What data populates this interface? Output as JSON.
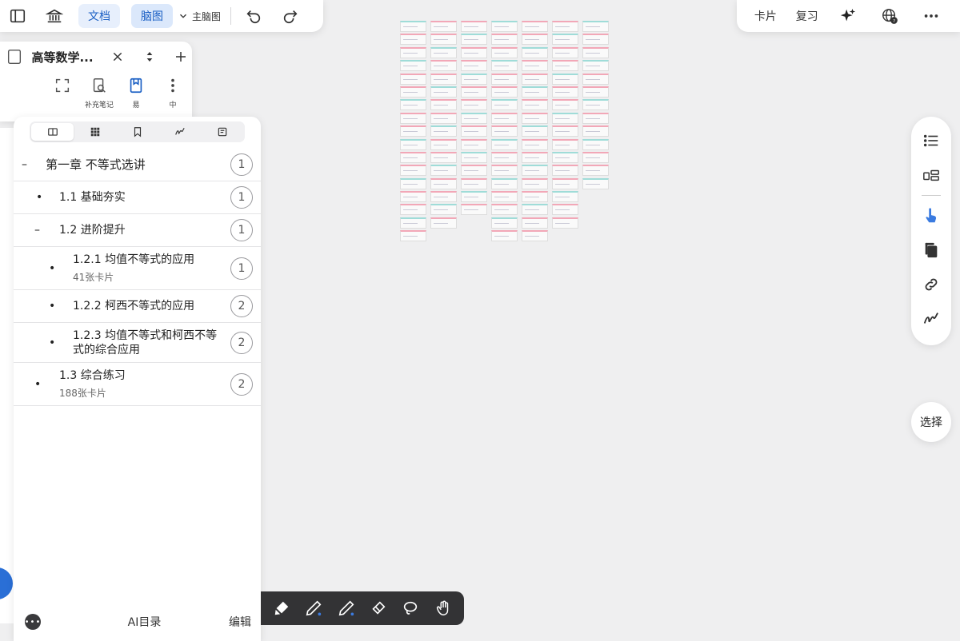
{
  "topbar_left": {
    "doc_label": "文档",
    "mindmap_label": "脑图",
    "main_mindmap_label": "主脑图"
  },
  "topbar_right": {
    "cards_label": "卡片",
    "review_label": "复习"
  },
  "notebook": {
    "title": "高等数学...",
    "tools": [
      {
        "label": "",
        "icon": "expand-icon"
      },
      {
        "label": "补充笔记",
        "icon": "search-note-icon"
      },
      {
        "label": "易",
        "icon": "book-icon"
      },
      {
        "label": "中",
        "icon": "more-vertical-icon"
      }
    ]
  },
  "outline": {
    "tabs": [
      "outline-tab",
      "grid-tab",
      "bookmark-tab",
      "ink-tab",
      "notes-tab"
    ],
    "items": [
      {
        "marker": "–",
        "text": "第一章 不等式选讲",
        "sub": "",
        "count": "1"
      },
      {
        "marker": "•",
        "text": "1.1 基础夯实",
        "sub": "",
        "count": "1"
      },
      {
        "marker": "–",
        "text": "1.2 进阶提升",
        "sub": "",
        "count": "1"
      },
      {
        "marker": "•",
        "text": "1.2.1 均值不等式的应用",
        "sub": "41张卡片",
        "count": "1"
      },
      {
        "marker": "•",
        "text": "1.2.2 柯西不等式的应用",
        "sub": "",
        "count": "2"
      },
      {
        "marker": "•",
        "text": "1.2.3 均值不等式和柯西不等式的综合应用",
        "sub": "",
        "count": "2"
      },
      {
        "marker": "•",
        "text": "1.3 综合练习",
        "sub": "188张卡片",
        "count": "2"
      }
    ],
    "ai_label": "AI目录",
    "edit_label": "编辑"
  },
  "right_sidebar": {
    "select_label": "选择"
  },
  "colors": {
    "accent": "#1a5fc4",
    "card_pink": "#f2a7b7",
    "card_teal": "#9fdcd8",
    "toolbar_dark": "#333335"
  }
}
